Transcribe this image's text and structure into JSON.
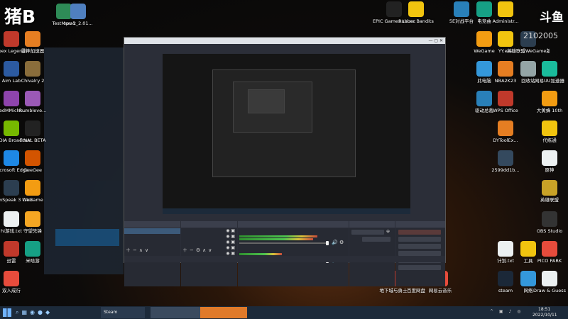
{
  "overlay": {
    "logo_text": "猪B",
    "watermark": "斗鱼",
    "room_number": "2102005"
  },
  "desktop_left": [
    {
      "label": "TestMem5",
      "color": "#2e8b57"
    },
    {
      "label": "cpu-z_2.01...",
      "color": "#4f7fbf"
    },
    {
      "label": "Apex Legends",
      "color": "#c0392b"
    },
    {
      "label": "雷神加速器",
      "color": "#e67e22"
    },
    {
      "label": "Aim Lab",
      "color": "#2c5aa0"
    },
    {
      "label": "Chivalry 2",
      "color": "#8a6d3b"
    },
    {
      "label": "BedMMichk...",
      "color": "#8e44ad"
    },
    {
      "label": "Rumbleve...",
      "color": "#9b59b6"
    },
    {
      "label": "NVIDIA Broadcast",
      "color": "#76b900"
    },
    {
      "label": "FINAL BETA",
      "color": "#222222"
    },
    {
      "label": "Microsoft Edge",
      "color": "#1e88e5"
    },
    {
      "label": "GeeGee",
      "color": "#d35400"
    },
    {
      "label": "TeamSpeak 3 Client",
      "color": "#2c3e50"
    },
    {
      "label": "WeGame",
      "color": "#f39c12"
    },
    {
      "label": "hi游戏.txt",
      "color": "#ecf0f1"
    },
    {
      "label": "守望先锋",
      "color": "#f5a623"
    },
    {
      "label": "迅雷",
      "color": "#c0392b"
    },
    {
      "label": "米哈游",
      "color": "#16a085"
    },
    {
      "label": "双人成行",
      "color": "#e74c3c"
    }
  ],
  "desktop_top": [
    {
      "label": "EPIC Games Launcher",
      "color": "#222222"
    },
    {
      "label": "Rubber Bandits",
      "color": "#f1c40f"
    },
    {
      "label": "5E对战平台",
      "color": "#2980b9"
    },
    {
      "label": "电竞曲",
      "color": "#16a085"
    },
    {
      "label": "Administr...",
      "color": "#f1c40f"
    }
  ],
  "desktop_right": [
    {
      "label": "WeGame",
      "color": "#f39c12"
    },
    {
      "label": "YY.exe",
      "color": "#f1c40f"
    },
    {
      "label": "英雄联盟WeGame版",
      "color": "#2c3e50"
    },
    {
      "label": "此电脑",
      "color": "#3498db"
    },
    {
      "label": "NBA2K23",
      "color": "#e67e22"
    },
    {
      "label": "回收站",
      "color": "#95a5a6"
    },
    {
      "label": "网易UU加速器",
      "color": "#1abc9c"
    },
    {
      "label": "驱动总裁",
      "color": "#2980b9"
    },
    {
      "label": "WPS Office",
      "color": "#c0392b"
    },
    {
      "label": "大黄蜂 10th",
      "color": "#f39c12"
    },
    {
      "label": "DYToolEx...",
      "color": "#e67e22"
    },
    {
      "label": "代练通",
      "color": "#f1c40f"
    },
    {
      "label": "2599dd1b...",
      "color": "#34495e"
    },
    {
      "label": "原神",
      "color": "#ecf0f1"
    },
    {
      "label": "英雄联盟",
      "color": "#c9a227"
    },
    {
      "label": "OBS Studio",
      "color": "#333333"
    },
    {
      "label": "计划.txt",
      "color": "#ecf0f1"
    },
    {
      "label": "工具",
      "color": "#f1c40f"
    },
    {
      "label": "PICO PARK",
      "color": "#e74c3c"
    },
    {
      "label": "steam",
      "color": "#1b2838"
    },
    {
      "label": "网络",
      "color": "#3498db"
    },
    {
      "label": "Draw & Guess",
      "color": "#ecf0f1"
    }
  ],
  "desktop_bottom": [
    {
      "label": "地下城与勇士",
      "color": "#c0392b"
    },
    {
      "label": "百度网盘",
      "color": "#3498db"
    },
    {
      "label": "网易云音乐",
      "color": "#e74c3c"
    }
  ],
  "obs": {
    "title": "",
    "menu": [
      "",
      "",
      "",
      "",
      "",
      "",
      "",
      ""
    ],
    "panels": {
      "scenes": "",
      "sources": "",
      "mixer": "",
      "transitions": "",
      "controls": ""
    },
    "scenes": [
      "",
      ""
    ],
    "sources": [
      "",
      "",
      "",
      "",
      ""
    ],
    "mixer_tracks": [
      {
        "name": ""
      },
      {
        "name": ""
      }
    ],
    "transition": {
      "type": "",
      "duration_label": "",
      "duration_value": ""
    },
    "controls": [
      "",
      "",
      "",
      "",
      "",
      ""
    ],
    "status": {
      "live": "",
      "rec": "",
      "cpu": ""
    },
    "nested_preview_label": ""
  },
  "taskbar": {
    "apps": [
      "Steam",
      "",
      ""
    ],
    "time": "18:51",
    "date": "2022/10/11"
  }
}
